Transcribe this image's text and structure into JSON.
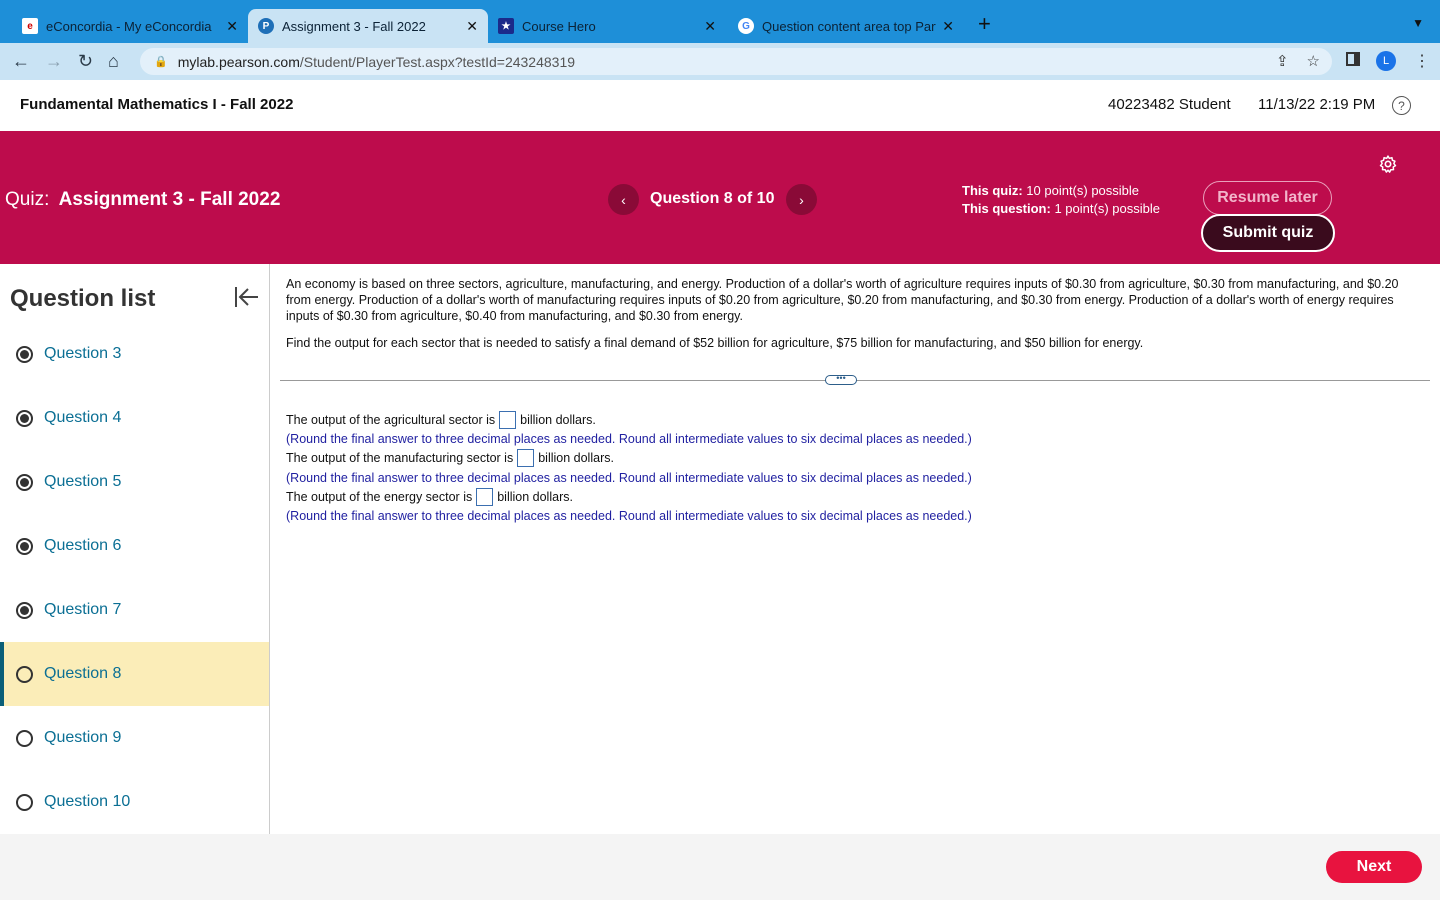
{
  "browser": {
    "tabs": [
      {
        "title": "eConcordia - My eConcordia",
        "active": false
      },
      {
        "title": "Assignment 3 - Fall 2022",
        "active": true
      },
      {
        "title": "Course Hero",
        "active": false
      },
      {
        "title": "Question content area top Part",
        "active": false
      }
    ],
    "url_domain": "mylab.pearson.com",
    "url_path": "/Student/PlayerTest.aspx?testId=243248319",
    "profile_initial": "L"
  },
  "header": {
    "course": "Fundamental Mathematics I - Fall 2022",
    "student": "40223482 Student",
    "datetime": "11/13/22 2:19 PM",
    "help": "?"
  },
  "banner": {
    "quiz_prefix": "Quiz:",
    "quiz_name": "Assignment 3 - Fall 2022",
    "question_counter": "Question 8 of 10",
    "quiz_points_label": "This quiz:",
    "quiz_points_value": "10 point(s) possible",
    "question_points_label": "This question:",
    "question_points_value": "1 point(s) possible",
    "resume_label": "Resume later",
    "submit_label": "Submit quiz"
  },
  "sidebar": {
    "title": "Question list",
    "items": [
      {
        "label": "Question 3",
        "answered": true
      },
      {
        "label": "Question 4",
        "answered": true
      },
      {
        "label": "Question 5",
        "answered": true
      },
      {
        "label": "Question 6",
        "answered": true
      },
      {
        "label": "Question 7",
        "answered": true
      },
      {
        "label": "Question 8",
        "answered": false,
        "current": true
      },
      {
        "label": "Question 9",
        "answered": false
      },
      {
        "label": "Question 10",
        "answered": false
      }
    ]
  },
  "question": {
    "problem": "An economy is based on three sectors, agriculture, manufacturing, and energy. Production of a dollar's worth of agriculture requires inputs of $0.30 from agriculture,  $0.30 from manufacturing, and $0.20 from energy. Production of a dollar's worth of manufacturing requires inputs of $0.20 from agriculture, $0.20 from manufacturing, and $0.30 from energy. Production of a dollar's worth of energy requires inputs of $0.30 from agriculture, $0.40 from manufacturing, and $0.30 from energy.",
    "task": "Find the output for each sector that is needed to satisfy a final demand of $52 billion for agriculture, $75 billion for manufacturing, and $50 billion for energy.",
    "divider_handle": "•••",
    "answers": [
      {
        "prefix": "The output of the agricultural sector is",
        "value": "",
        "suffix": "billion dollars.",
        "hint": "(Round the final answer to three decimal places as needed. Round all intermediate values to six decimal places as needed.)"
      },
      {
        "prefix": "The output of the manufacturing sector is",
        "value": "",
        "suffix": "billion dollars.",
        "hint": "(Round the final answer to three decimal places as needed. Round all intermediate values to six decimal places as needed.)"
      },
      {
        "prefix": "The output of the energy sector is",
        "value": "",
        "suffix": "billion dollars.",
        "hint": "(Round the final answer to three decimal places as needed. Round all intermediate values to six decimal places as needed.)"
      }
    ]
  },
  "footer": {
    "next_label": "Next"
  },
  "colors": {
    "banner": "#bd0c4c",
    "current_item_bg": "#fbedb8",
    "next_button": "#e8133f",
    "link": "#0b6f94"
  }
}
